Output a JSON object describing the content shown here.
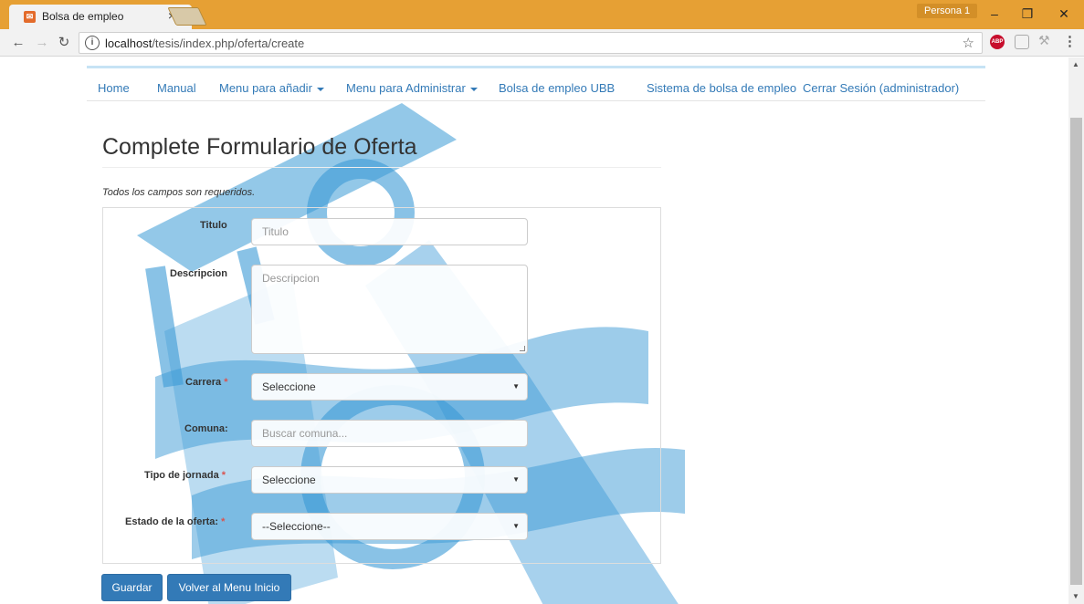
{
  "browser": {
    "tab_title": "Bolsa de empleo",
    "tab_close": "×",
    "profile": "Persona 1",
    "url_host": "localhost",
    "url_path": "/tesis/index.php/oferta/create",
    "abp_label": "ABP"
  },
  "navbar": {
    "items": [
      {
        "label": "Home"
      },
      {
        "label": "Manual"
      },
      {
        "label": "Menu para añadir"
      },
      {
        "label": "Menu para Administrar"
      },
      {
        "label": "Bolsa de empleo UBB"
      },
      {
        "label": "Sistema de bolsa de empleo"
      },
      {
        "label": "Cerrar Sesión (administrador)"
      }
    ]
  },
  "form": {
    "title": "Complete Formulario de Oferta",
    "note": "Todos los campos son requeridos.",
    "titulo": {
      "label": "Titulo",
      "placeholder": "Titulo"
    },
    "descripcion": {
      "label": "Descripcion",
      "placeholder": "Descripcion"
    },
    "carrera": {
      "label": "Carrera",
      "required": "*",
      "value": "Seleccione"
    },
    "comuna": {
      "label": "Comuna:",
      "placeholder": "Buscar comuna..."
    },
    "jornada": {
      "label": "Tipo de jornada",
      "required": "*",
      "value": "Seleccione"
    },
    "estado": {
      "label": "Estado de la oferta:",
      "required": "*",
      "value": "--Seleccione--"
    },
    "save_label": "Guardar",
    "back_label": "Volver al Menu Inicio"
  },
  "colors": {
    "accent": "#337ab7",
    "titlebar": "#e6a034",
    "watermark": "#3b9ad6"
  }
}
